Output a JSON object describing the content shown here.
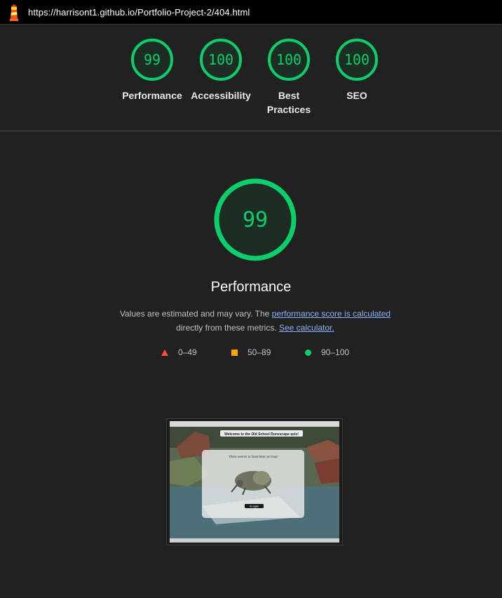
{
  "address_bar": {
    "url": "https://harrisont1.github.io/Portfolio-Project-2/404.html",
    "icon": "lighthouse-icon"
  },
  "gauges": [
    {
      "label": "Performance",
      "score": "99",
      "score_value": 99
    },
    {
      "label": "Accessibility",
      "score": "100",
      "score_value": 100
    },
    {
      "label": "Best Practices",
      "score": "100",
      "score_value": 100
    },
    {
      "label": "SEO",
      "score": "100",
      "score_value": 100
    }
  ],
  "main": {
    "score": "99",
    "score_value": 99,
    "title": "Performance",
    "desc_prefix": "Values are estimated and may vary. The ",
    "desc_link": "performance score is calculated",
    "desc_mid": "directly from these metrics.",
    "desc_link2": "See calculator."
  },
  "legend": [
    {
      "range": "0–49",
      "shape": "triangle",
      "color": "#ff4e42"
    },
    {
      "range": "50–89",
      "shape": "square",
      "color": "#ffa400"
    },
    {
      "range": "90–100",
      "shape": "circle",
      "color": "#0cce6b"
    }
  ],
  "screenshot": {
    "banner": "Welcome to the Old School Runescape quiz!",
    "modal_text": "There seems to have been an bug!",
    "button": "Go again"
  },
  "colors": {
    "pass": "#0cce6b",
    "average": "#ffa400",
    "fail": "#ff4e42",
    "link": "#8ab4f8"
  }
}
